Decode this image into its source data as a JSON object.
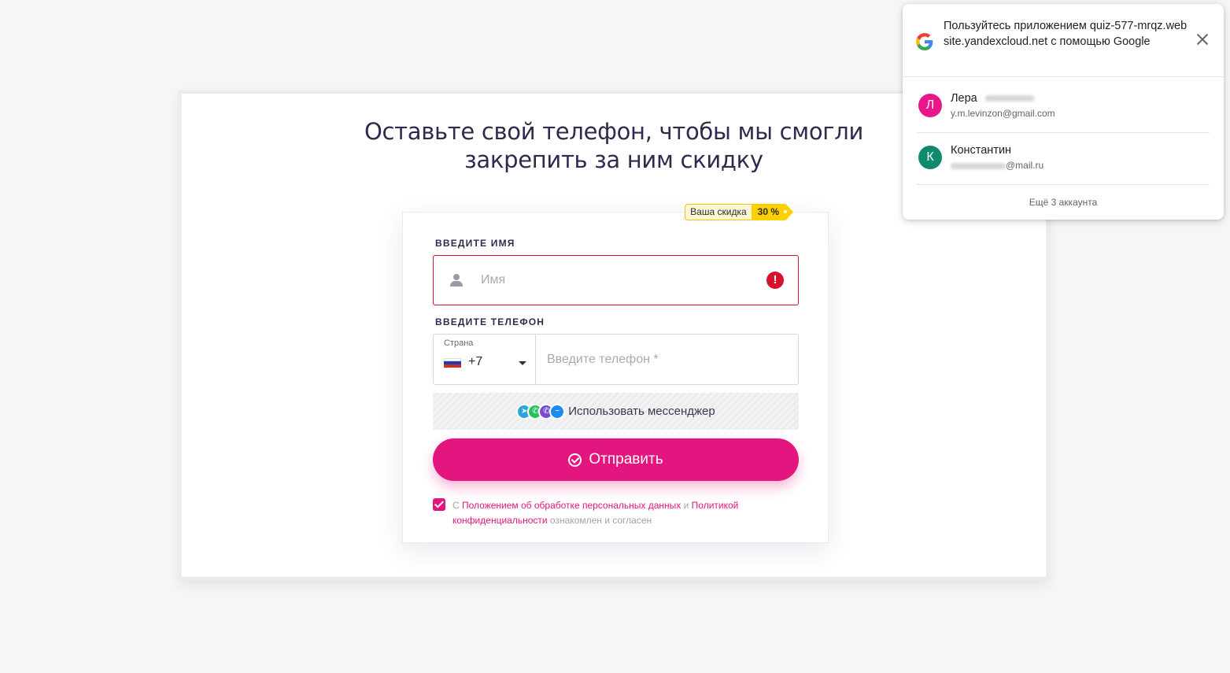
{
  "quiz": {
    "title_line1": "Оставьте свой телефон, чтобы мы смогли",
    "title_line2": "закрепить за ним скидку",
    "discount": {
      "label": "Ваша скидка",
      "value": "30 %"
    },
    "name_field": {
      "label": "ВВЕДИТЕ ИМЯ",
      "placeholder": "Имя",
      "error_icon": "!"
    },
    "phone_field": {
      "label": "ВВЕДИТЕ ТЕЛЕФОН",
      "country_label": "Страна",
      "country_code": "+7",
      "placeholder": "Введите телефон *"
    },
    "messenger_button": "Использовать мессенджер",
    "submit_button": "Отправить",
    "consent": {
      "prefix": "С ",
      "link1": "Положением об обработке персональных данных",
      "middle": " и ",
      "link2": "Политикой конфиденциальности",
      "suffix": " ознакомлен и согласен",
      "checked": true
    }
  },
  "google_popup": {
    "title": "Пользуйтесь приложением quiz-577-mrqz.website.yandexcloud.net с помощью Google",
    "accounts": [
      {
        "initial": "Л",
        "name": "Лера",
        "email": "y.m.levinzon@gmail.com",
        "color": "#e8178a"
      },
      {
        "initial": "К",
        "name": "Константин",
        "email": "@mail.ru",
        "color": "#0f8a6d"
      }
    ],
    "more_accounts": "Ещё 3 аккаунта"
  },
  "colors": {
    "accent": "#e3157f",
    "error": "#d8112d",
    "discount_yellow": "#ffd000"
  }
}
